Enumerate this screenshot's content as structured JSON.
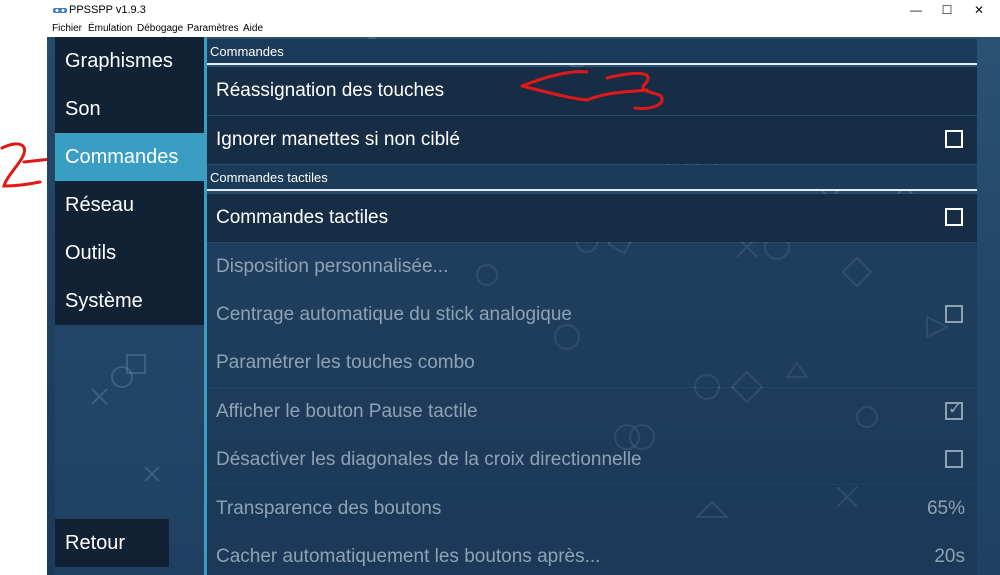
{
  "window": {
    "title": "PPSSPP v1.9.3",
    "controls": [
      "—",
      "☐",
      "✕"
    ]
  },
  "menu": [
    "Fichier",
    "Émulation",
    "Débogage",
    "Paramètres",
    "Aide"
  ],
  "sidebar": {
    "items": [
      "Graphismes",
      "Son",
      "Commandes",
      "Réseau",
      "Outils",
      "Système"
    ],
    "selected": "Commandes",
    "back": "Retour"
  },
  "sections": {
    "commandes": {
      "header": "Commandes",
      "rows": [
        {
          "label": "Réassignation des touches"
        },
        {
          "label": "Ignorer manettes si non ciblé",
          "checked": false
        }
      ]
    },
    "tactiles": {
      "header": "Commandes tactiles",
      "rows": [
        {
          "label": "Commandes tactiles",
          "checked": false,
          "enabled": true
        },
        {
          "label": "Disposition personnalisée...",
          "enabled": false
        },
        {
          "label": "Centrage automatique du stick analogique",
          "checked": false,
          "enabled": false
        },
        {
          "label": "Paramétrer les touches combo",
          "enabled": false
        },
        {
          "label": "Afficher le bouton Pause tactile",
          "checked": true,
          "enabled": false
        },
        {
          "label": "Désactiver les diagonales de la croix directionnelle",
          "checked": false,
          "enabled": false
        },
        {
          "label": "Transparence des boutons",
          "value": "65%",
          "enabled": false
        },
        {
          "label": "Cacher automatiquement les boutons après...",
          "value": "20s",
          "enabled": false
        }
      ]
    }
  },
  "colors": {
    "accent": "#3a9ec2",
    "annotation": "#e01818"
  },
  "icons": [
    "ppsspp-logo-icon",
    "minimize-icon",
    "maximize-icon",
    "close-icon",
    "checkbox-icon",
    "checkmark-icon"
  ]
}
